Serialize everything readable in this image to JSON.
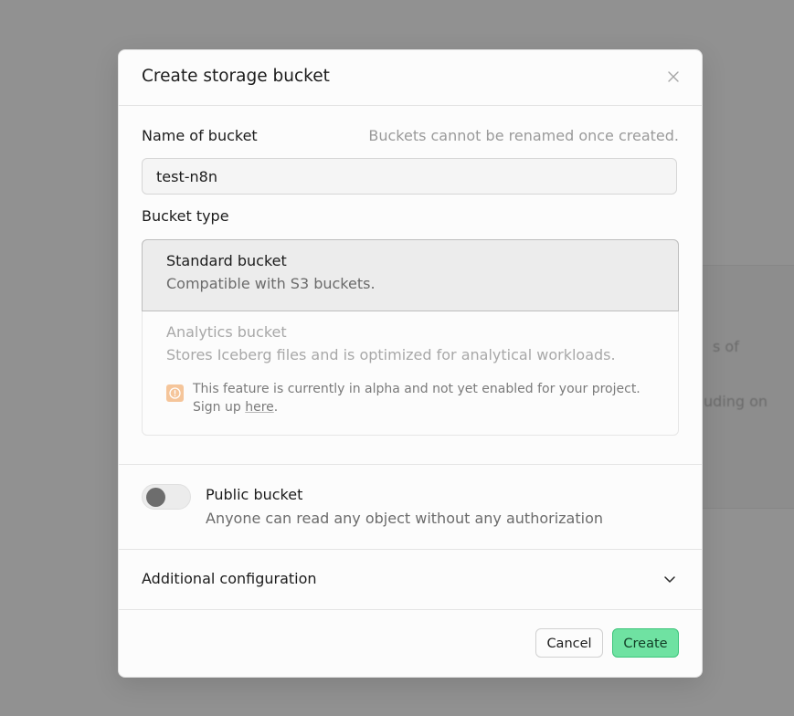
{
  "modal": {
    "title": "Create storage bucket",
    "name_label": "Name of bucket",
    "name_hint": "Buckets cannot be renamed once created.",
    "name_value": "test-n8n",
    "type_label": "Bucket type",
    "types": [
      {
        "title": "Standard bucket",
        "description": "Compatible with S3 buckets.",
        "selected": true
      },
      {
        "title": "Analytics bucket",
        "description": "Stores Iceberg files and is optimized for analytical workloads.",
        "selected": false,
        "disabled": true,
        "note_text": "This feature is currently in alpha and not yet enabled for your project. Sign up ",
        "note_link": "here",
        "note_end": "."
      }
    ],
    "public_title": "Public bucket",
    "public_description": "Anyone can read any object without any authorization",
    "public_enabled": false,
    "additional_config": "Additional configuration",
    "cancel_label": "Cancel",
    "create_label": "Create"
  },
  "colors": {
    "overlay": "#919191",
    "accent": "#6fe2a2",
    "alpha_icon": "#f5c59a"
  }
}
